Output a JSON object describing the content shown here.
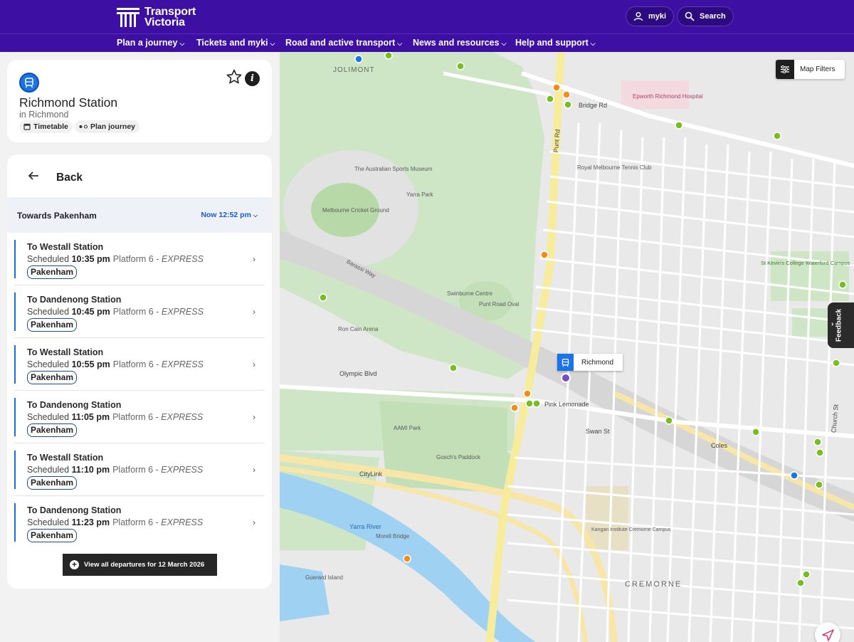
{
  "header": {
    "logo_line1": "Transport",
    "logo_line2": "Victoria",
    "myki_label": "myki",
    "search_label": "Search"
  },
  "nav": {
    "items": [
      {
        "label": "Plan a journey"
      },
      {
        "label": "Tickets and myki"
      },
      {
        "label": "Road and active transport"
      },
      {
        "label": "News and resources"
      },
      {
        "label": "Help and support"
      }
    ]
  },
  "station": {
    "name": "Richmond Station",
    "suburb": "in Richmond",
    "timetable_label": "Timetable",
    "plan_label": "Plan journey"
  },
  "departures": {
    "back_label": "Back",
    "direction": "Towards Pakenham",
    "time_selector": "Now 12:52 pm",
    "items": [
      {
        "destination": "To Westall Station",
        "scheduled_prefix": "Scheduled",
        "time": "10:35 pm",
        "platform": "Platform 6 -",
        "type": "EXPRESS",
        "line": "Pakenham"
      },
      {
        "destination": "To Dandenong Station",
        "scheduled_prefix": "Scheduled",
        "time": "10:45 pm",
        "platform": "Platform 6 -",
        "type": "EXPRESS",
        "line": "Pakenham"
      },
      {
        "destination": "To Westall Station",
        "scheduled_prefix": "Scheduled",
        "time": "10:55 pm",
        "platform": "Platform 6 -",
        "type": "EXPRESS",
        "line": "Pakenham"
      },
      {
        "destination": "To Dandenong Station",
        "scheduled_prefix": "Scheduled",
        "time": "11:05 pm",
        "platform": "Platform 6 -",
        "type": "EXPRESS",
        "line": "Pakenham"
      },
      {
        "destination": "To Westall Station",
        "scheduled_prefix": "Scheduled",
        "time": "11:10 pm",
        "platform": "Platform 6 -",
        "type": "EXPRESS",
        "line": "Pakenham"
      },
      {
        "destination": "To Dandenong Station",
        "scheduled_prefix": "Scheduled",
        "time": "11:23 pm",
        "platform": "Platform 6 -",
        "type": "EXPRESS",
        "line": "Pakenham"
      }
    ],
    "view_all_label": "View all departures for 12 March 2026"
  },
  "map": {
    "filter_label": "Map Filters",
    "selected_station_label": "Richmond",
    "feedback_label": "Feedback",
    "labels": {
      "jolimont": "JOLIMONT",
      "cremorne": "CREMORNE",
      "mcg": "Melbourne Cricket Ground",
      "yarra_park": "Yarra Park",
      "sports_museum": "The Australian Sports Museum",
      "epworth": "Epworth Richmond Hospital",
      "punt_rd": "Punt Rd",
      "bridge_rd": "Bridge Rd",
      "olympic_blvd": "Olympic Blvd",
      "citylink": "CityLink",
      "yarra_river": "Yarra River",
      "swan_st": "Swan St",
      "church_st": "Church St",
      "richmond_tennis": "Royal Melbourne Tennis Club",
      "aami_park": "AAMI Park",
      "goschs": "Gosch's Paddock",
      "guerard": "Guerard Island",
      "morell": "Morell Bridge",
      "barassi": "Barassi Way",
      "punt_oval": "Punt Road Oval",
      "swinburne": "Swinburne Centre",
      "rod_laver": "Ron Cain Arena",
      "st_kevins": "St Kevin's College Waterford Campus",
      "kangan": "Kangan Institute Cremorne Campus",
      "pink_lemonade": "Pink Lemonade",
      "coles": "Coles"
    },
    "colors": {
      "accent": "#3d0fa3",
      "train_stop": "#1a73e8",
      "tram_stop": "#78be20",
      "bus_stop": "#f28c1b",
      "selected_stop": "#7b4fc4"
    }
  }
}
